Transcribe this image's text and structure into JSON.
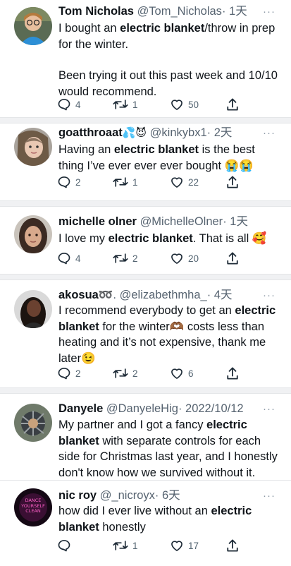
{
  "tweets": [
    {
      "name": "Tom Nicholas",
      "handle": "@Tom_Nicholas",
      "time": "· 1天",
      "text_parts": [
        "I bought an ",
        "electric blanket",
        "/throw in prep for the winter."
      ],
      "text_p2": "Been trying it out this past week and 10/10 would recommend.",
      "replies": "4",
      "retweets": "1",
      "likes": "50"
    },
    {
      "name": "goatthroaat",
      "handle": "@kinkybx1",
      "time": "· 2天",
      "name_emoji": "💦😈",
      "text_parts": [
        "Having an ",
        "electric blanket",
        " is the best thing I’ve ever ever ever bought 😭😭"
      ],
      "replies": "2",
      "retweets": "1",
      "likes": "22"
    },
    {
      "name": "michelle olner",
      "handle": "@MichelleOlner",
      "time": "· 1天",
      "text_parts": [
        "I love my ",
        "electric blanket",
        ".  That is all 🥰"
      ],
      "replies": "4",
      "retweets": "2",
      "likes": "20"
    },
    {
      "name": "akosua",
      "handle": "@elizabethmha_",
      "time": "· 4天",
      "name_emoji": "➿.",
      "text_parts": [
        "I recommend everybody to get an ",
        "electric blanket",
        " for the winter🫶🏾 costs less than heating and it’s not expensive, thank me later😉"
      ],
      "replies": "2",
      "retweets": "2",
      "likes": "6"
    },
    {
      "name": "Danyele",
      "handle": "@DanyeleHig",
      "time": "· 2022/10/12",
      "text_parts": [
        "My partner and I got a fancy ",
        "electric blanket",
        " with separate controls for each side for Christmas last year, and I honestly don't know how we survived without it."
      ]
    },
    {
      "name": "nic roy",
      "handle": "@_nicroyx",
      "time": "· 6天",
      "avatar_text": "DANCE YOURSELF CLEAN",
      "text_parts": [
        "how did I ever live without an ",
        "electric blanket",
        " honestly"
      ],
      "retweets": "1",
      "likes": "17"
    }
  ],
  "more_label": "···",
  "icons": {
    "reply": "reply-icon",
    "retweet": "retweet-icon",
    "like": "heart-icon",
    "share": "share-icon"
  },
  "colors": {
    "text": "#0f1419",
    "meta": "#536471",
    "separator": "#f0f1f3"
  }
}
